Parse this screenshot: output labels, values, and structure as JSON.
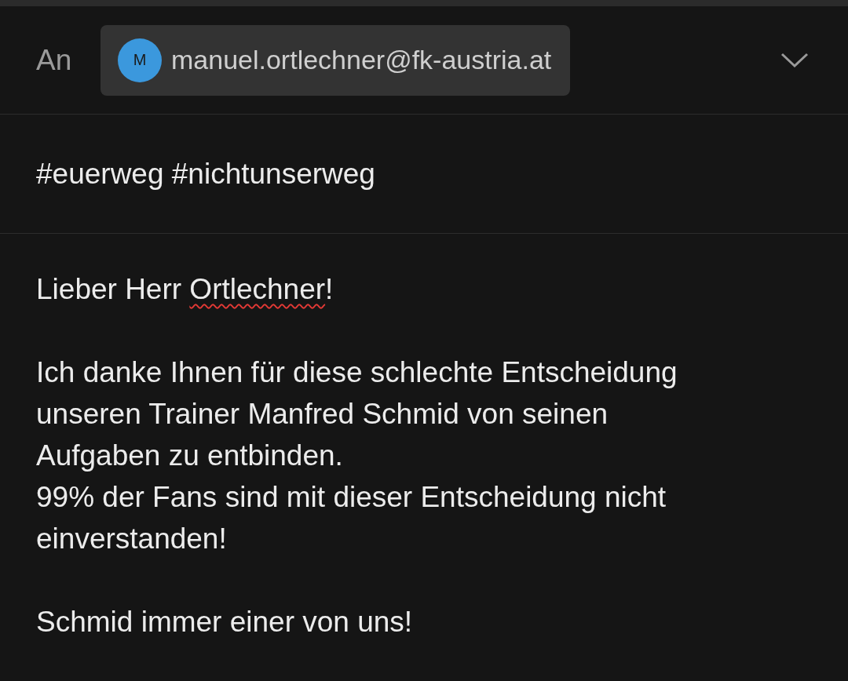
{
  "recipient": {
    "label": "An",
    "avatar_initial": "M",
    "address": "manuel.ortlechner@fk-austria.at"
  },
  "subject": "#euerweg #nichtunserweg",
  "body": {
    "paragraphs": [
      {
        "lines": [
          [
            {
              "text": "Lieber Herr ",
              "misspelled": false
            },
            {
              "text": "Ortlechner",
              "misspelled": true
            },
            {
              "text": "!",
              "misspelled": false
            }
          ]
        ]
      },
      {
        "lines": [
          [
            {
              "text": "Ich danke Ihnen für diese schlechte Entscheidung",
              "misspelled": false
            }
          ],
          [
            {
              "text": "unseren Trainer Manfred Schmid von seinen",
              "misspelled": false
            }
          ],
          [
            {
              "text": "Aufgaben zu entbinden.",
              "misspelled": false
            }
          ],
          [
            {
              "text": "99% der Fans sind mit dieser Entscheidung nicht",
              "misspelled": false
            }
          ],
          [
            {
              "text": "einverstanden!",
              "misspelled": false
            }
          ]
        ]
      },
      {
        "lines": [
          [
            {
              "text": "Schmid immer einer von uns!",
              "misspelled": false
            }
          ]
        ]
      }
    ]
  }
}
